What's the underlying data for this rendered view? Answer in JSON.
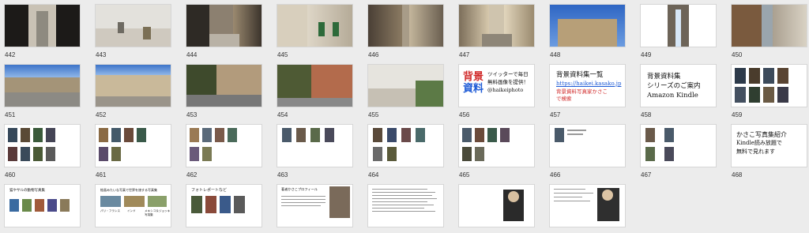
{
  "rows": [
    {
      "labels": [
        "442",
        "443",
        "444",
        "445",
        "446",
        "447",
        "448",
        "449",
        "450"
      ]
    },
    {
      "labels": [
        "451",
        "452",
        "453",
        "454",
        "455",
        "456",
        "457",
        "458",
        "459"
      ]
    },
    {
      "labels": [
        "460",
        "461",
        "462",
        "463",
        "464",
        "465",
        "466",
        "467",
        "468"
      ]
    }
  ],
  "slide456": {
    "title_top": "背景",
    "title_bottom": "資料",
    "line1": "ツイッターで毎日",
    "line2": "無料画像を提供！",
    "line3": "@haikeiphoto"
  },
  "slide457": {
    "title": "背景資料集一覧",
    "link": "https://haikei.kasako.jp",
    "sub1": "背景資料写真家かさこ",
    "sub2": "で検索"
  },
  "slide458": {
    "line1": "背景資料集",
    "line2": "シリーズのご案内",
    "line3": "Amazon Kindle"
  },
  "slide468": {
    "line1": "かさこ写真集紹介",
    "line2": "Kindle読み放題で",
    "line3": "無料で見れます"
  },
  "row4": {
    "a": "猫やサルの動物写真集",
    "b": "絵画みたいな写真で世界を旅する写真集",
    "b_captions": [
      "パリ・フランス",
      "インド",
      "メキシコ＆ジョッキ写真集"
    ],
    "c": "フォトレポートなど",
    "d": "著者かさこプロフィール"
  },
  "colors": {
    "bg": "#ececec",
    "accent_blue": "#1e5bd6",
    "accent_red": "#d02a2a"
  }
}
